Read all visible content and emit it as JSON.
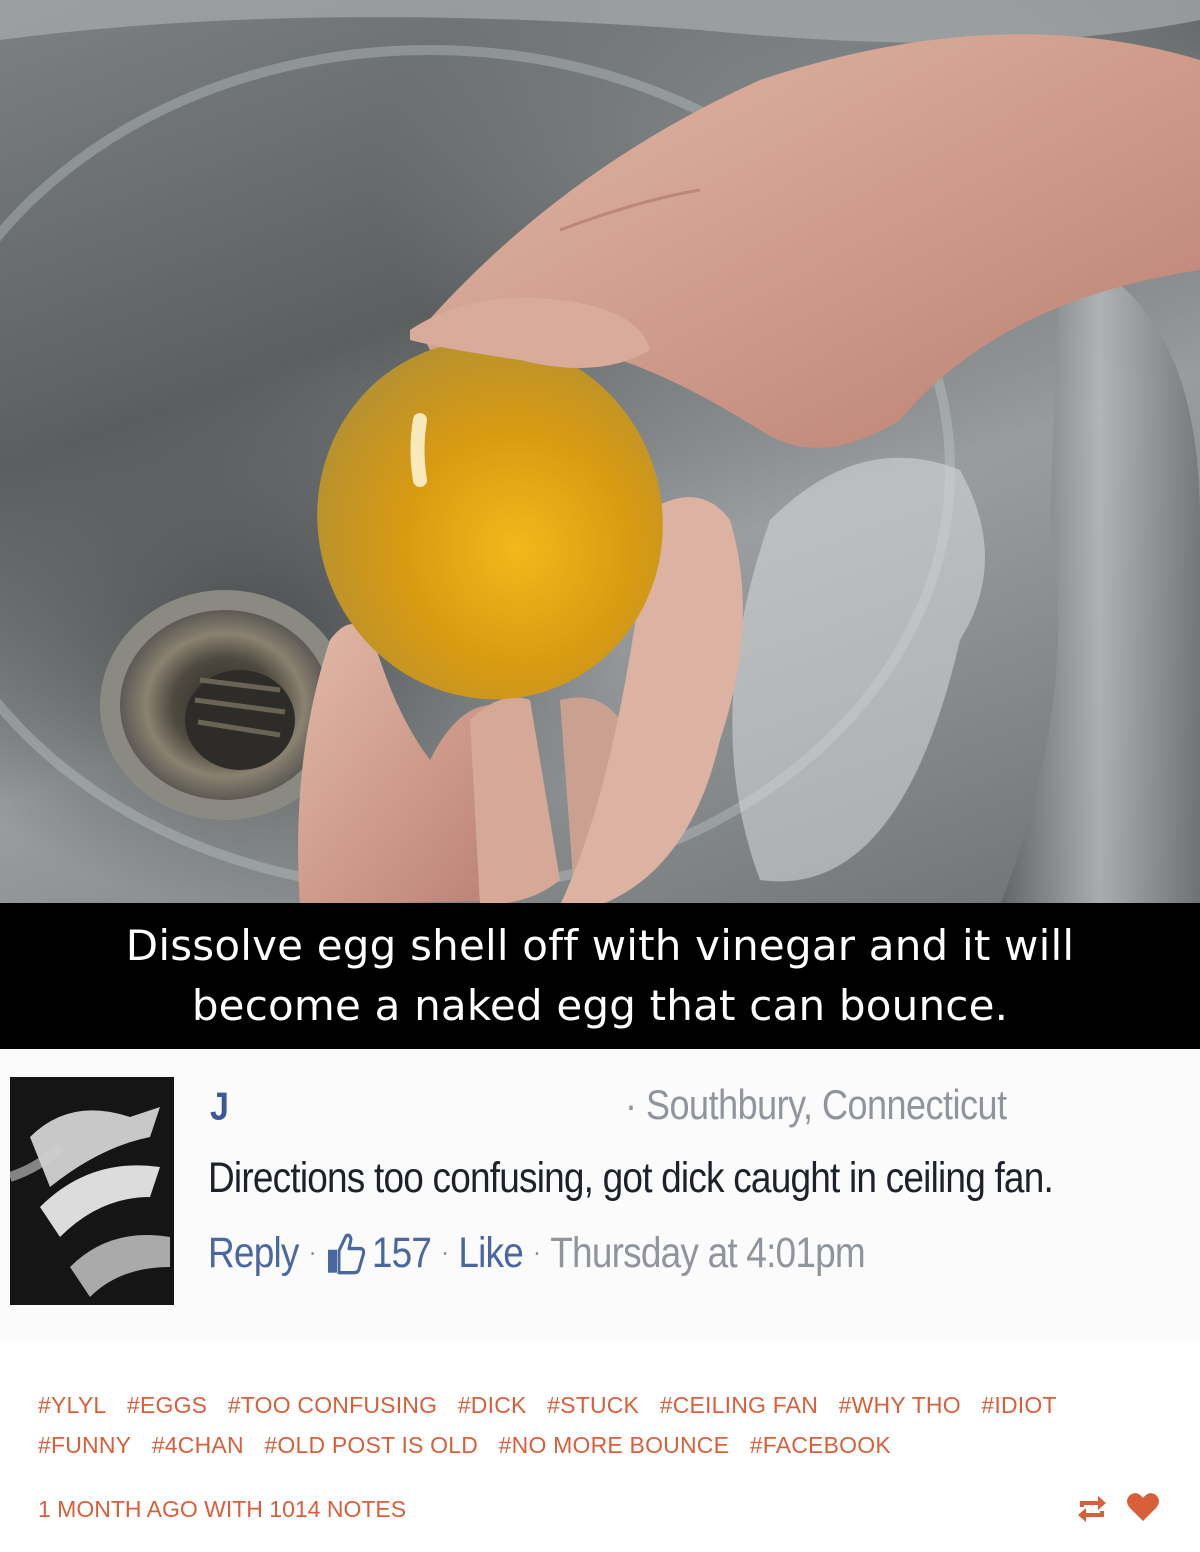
{
  "caption": {
    "line1": "Dissolve egg shell off with vinegar and it will",
    "line2": "become a naked egg that can bounce."
  },
  "comment": {
    "author": "J",
    "location": "Southbury, Connecticut",
    "text": "Directions too confusing, got dick caught in ceiling fan.",
    "reply_label": "Reply",
    "like_count": "157",
    "like_label": "Like",
    "timestamp": "Thursday at 4:01pm",
    "separator": "·"
  },
  "post": {
    "tags": [
      "#YLYL",
      "#EGGS",
      "#TOO CONFUSING",
      "#DICK",
      "#STUCK",
      "#CEILING FAN",
      "#WHY THO",
      "#IDIOT",
      "#FUNNY",
      "#4CHAN",
      "#OLD POST IS OLD",
      "#NO MORE BOUNCE",
      "#FACEBOOK"
    ],
    "meta": "1 MONTH AGO WITH 1014 NOTES"
  },
  "icons": {
    "like": "thumbs-up-icon",
    "reblog": "reblog-icon",
    "heart": "heart-icon"
  },
  "colors": {
    "tag_accent": "#d95f3b",
    "fb_link": "#4b67a1",
    "caption_bg": "#000000"
  }
}
